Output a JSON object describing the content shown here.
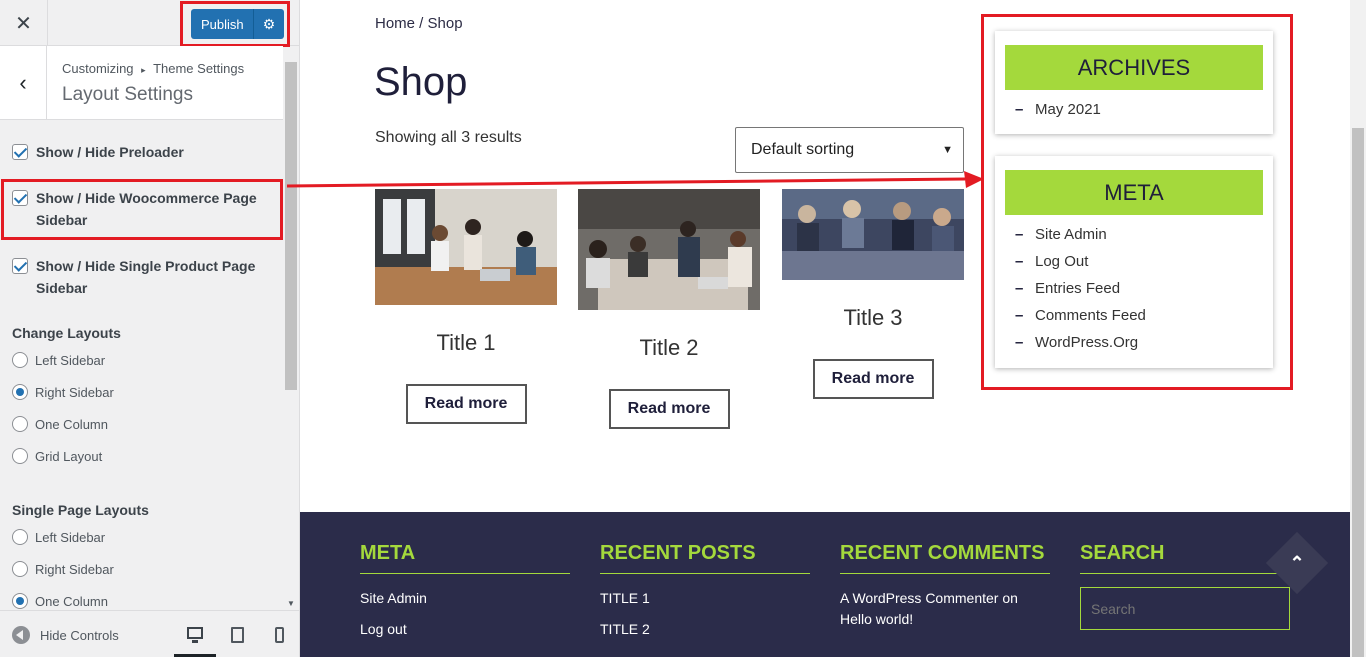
{
  "customizer": {
    "close_glyph": "✕",
    "publish_label": "Publish",
    "settings_glyph": "⚙",
    "back_glyph": "‹",
    "crumb_root": "Customizing",
    "crumb_sep": "▸",
    "crumb_parent": "Theme Settings",
    "section_title": "Layout Settings",
    "checkboxes": [
      {
        "label": "Show / Hide Preloader",
        "checked": true
      },
      {
        "label": "Show / Hide Woocommerce Page Sidebar",
        "checked": true
      },
      {
        "label": "Show / Hide Single Product Page Sidebar",
        "checked": true
      }
    ],
    "change_layouts": {
      "title": "Change Layouts",
      "options": [
        {
          "label": "Left Sidebar",
          "selected": false
        },
        {
          "label": "Right Sidebar",
          "selected": true
        },
        {
          "label": "One Column",
          "selected": false
        },
        {
          "label": "Grid Layout",
          "selected": false
        }
      ]
    },
    "single_page_layouts": {
      "title": "Single Page Layouts",
      "options": [
        {
          "label": "Left Sidebar",
          "selected": false
        },
        {
          "label": "Right Sidebar",
          "selected": false
        },
        {
          "label": "One Column",
          "selected": true
        }
      ]
    },
    "hide_controls_label": "Hide Controls",
    "scroll_arrow": "▼",
    "devices": [
      "desktop-icon",
      "tablet-icon",
      "mobile-icon"
    ]
  },
  "preview": {
    "breadcrumb": "Home / Shop",
    "page_title": "Shop",
    "result_count": "Showing all 3 results",
    "sort_value": "Default sorting",
    "sort_caret": "⌄",
    "products": [
      {
        "title": "Title 1",
        "button": "Read more"
      },
      {
        "title": "Title 2",
        "button": "Read more"
      },
      {
        "title": "Title 3",
        "button": "Read more"
      }
    ],
    "archives": {
      "title": "ARCHIVES",
      "items": [
        "May 2021"
      ]
    },
    "meta": {
      "title": "META",
      "items": [
        "Site Admin",
        "Log Out",
        "Entries Feed",
        "Comments Feed",
        "WordPress.Org"
      ]
    },
    "footer": {
      "meta": {
        "title": "META",
        "items": [
          "Site Admin",
          "Log out"
        ]
      },
      "recent_posts": {
        "title": "RECENT POSTS",
        "items": [
          "TITLE 1",
          "TITLE 2"
        ]
      },
      "recent_comments": {
        "title": "RECENT COMMENTS",
        "items": [
          "A WordPress Commenter on Hello world!"
        ]
      },
      "search": {
        "title": "SEARCH",
        "placeholder": "Search"
      }
    },
    "to_top_glyph": "⌃"
  },
  "colors": {
    "accent_green": "#a4d93c",
    "footer_bg": "#2b2c4a",
    "highlight_red": "#e31b23",
    "wp_blue": "#2271b1"
  }
}
